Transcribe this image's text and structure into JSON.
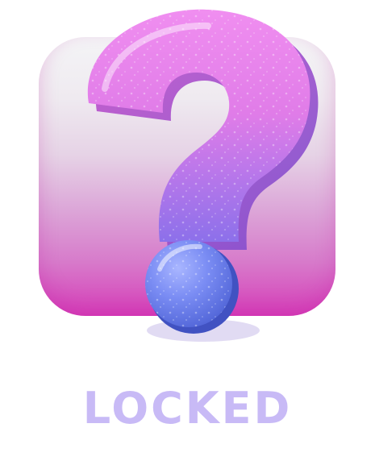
{
  "card": {
    "status_label": "LOCKED",
    "icon": "question-mark-icon"
  },
  "colors": {
    "label": "#c8baf6",
    "tile_top": "#f4f4f6",
    "tile_bottom": "#d640b9",
    "mark_pink": "#e27be6",
    "mark_purple": "#9a6ee6",
    "dot_blue": "#6f86f2"
  }
}
